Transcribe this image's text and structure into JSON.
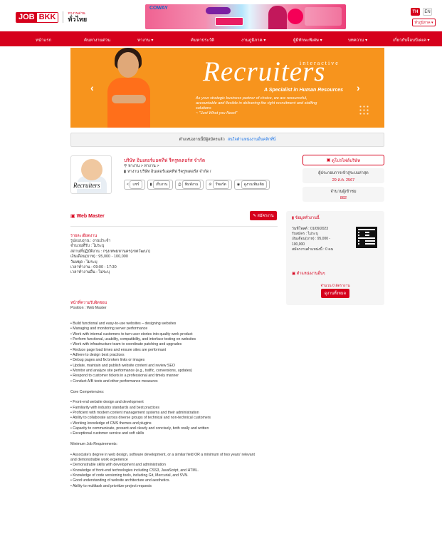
{
  "header": {
    "logo_job": "JOB",
    "logo_bkk": "BKK",
    "logo_sub1": "หางานด่วน",
    "logo_sub2": "ทั่วไทย",
    "banner_brand": "COWAY",
    "lang_th": "TH",
    "lang_en": "EN",
    "region": "ทั่วภูมิภาค ▾"
  },
  "nav": [
    "หน้าแรก",
    "ค้นหางานด่วน",
    "หางาน ▾",
    "ค้นหาประวัติ",
    "งานภูมิภาค ▾",
    "ผู้มีทักษะพิเศษ ▾",
    "บทความ ▾",
    "เกี่ยวกับจ็อบบีเคเค ▾"
  ],
  "hero": {
    "small": "interactive",
    "big": "Recruiters",
    "tagline": "A Specialist in Human Resources",
    "desc": "As your strategic business partner of choice, we are resourceful, accountable and flexible in delivering the right recruitment and staffing solutions",
    "quote": "~ \"Just What you Need\"",
    "prev": "‹",
    "next": "›"
  },
  "strip": {
    "text": "ตำแหน่งงานนี้มีผู้สมัครแล้ว",
    "link": "สนใจตำแหน่งงานอื่นคลิกที่นี่"
  },
  "company": {
    "logo_text": "Recruiters",
    "name": "บริษัท อินเตอร์แอคทีฟ รีครูทเตอร์ส จำกัด",
    "line1": "หางาน > หางาน >",
    "line2": "หางาน บริษัท อินเตอร์แอคทีฟ รีครูทเตอร์ส จำกัด /",
    "actions": [
      "แชร์",
      "เก็บงาน",
      "พิมพ์งาน",
      "รีพอร์ต",
      "ดูงานเพิ่มเติม"
    ],
    "view_company": "ดูโปรไฟล์บริษัท",
    "updated_label": "ผู้ประกอบการเข้าสู่ระบบล่าสุด",
    "updated_date": "29 ส.ค. 2567",
    "views_label": "จำนวนผู้เข้าชม",
    "views_value": "882"
  },
  "job": {
    "title": "Web Master",
    "apply": "สมัครงาน",
    "detail_heading": "รายละเอียดงาน",
    "details": [
      "รูปแบบงาน : งานประจำ",
      "จำนวนที่รับ : ไม่ระบุ",
      "สถานที่ปฏิบัติงาน : กรุงเทพมหานคร(เขตวัฒนา)",
      "เงินเดือน(บาท) : 95,000 - 100,000",
      "วันหยุด : ไม่ระบุ",
      "เวลาทำงาน : 09:00 - 17:30",
      "เวลาทำงานอื่น : ไม่ระบุ"
    ],
    "duties_heading": "หน้าที่ความรับผิดชอบ",
    "body": [
      "Position : Web Master",
      "",
      "",
      "• Build functional and easy-to-use websites – designing websites",
      "• Managing and monitoring server performance",
      "• Work with internal customers to turn user stories into quality work product",
      "• Perform functional, usability, compatibility, and interface testing on websites",
      "• Work with infrastructure team to coordinate patching and upgrades",
      "• Reduce page load times and ensure sites are performant",
      "• Adhere to design best practices",
      "• Debug pages and fix broken links or images",
      "• Update, maintain and publish website content and review SEO",
      "• Monitor and analyze site performance (e.g., traffic, conversions, updates)",
      "• Respond to customer tickets in a professional and timely manner",
      "• Conduct A/B tests and other performance measures",
      "",
      "Core Competencies:",
      "",
      "• Front-end website design and development",
      "• Familiarity with industry standards and best practices",
      "• Proficient with modern content management systems and their administration",
      "• Ability to collaborate across diverse groups of technical and non-technical customers",
      "• Working knowledge of CMS themes and plugins",
      "• Capacity to communicate, present and clearly and concisely, both orally and written",
      "• Exceptional customer service and soft skills",
      "",
      "Minimum Job Requirements:",
      "",
      "• Associate's degree in web design, software development, or a similar field OR a minimum of two years' relevant",
      "  and demonstrable work experience",
      "• Demonstrable skills with development and administration",
      "• Knowledge of front-end technologies including CSS3, JavaScript, and HTML.",
      "• Knowledge of code versioning tools, including Git, Mercurial, and SVN.",
      "• Good understanding of website architecture and aesthetics.",
      "• Ability to multitask and prioritize project requests"
    ]
  },
  "panel": {
    "heading": "ข้อมูลทั่วงานนี้",
    "meta": [
      "วันที่โพสต์ : 01/09/2023",
      "รับสมัคร : ไม่ระบุ",
      "เงินเดือน(บาท) : 95,000 -",
      "100,000",
      "สมัครงานตำแหน่งนี้ : 0 คน"
    ],
    "other_heading": "ตำแหน่งงานอื่นๆ",
    "count": "จำนวน 0 อัตรางาน",
    "all_button": "ดูงานทั้งหมด"
  },
  "colors": {
    "accent": "#d6001c",
    "hero": "#f7941d"
  }
}
